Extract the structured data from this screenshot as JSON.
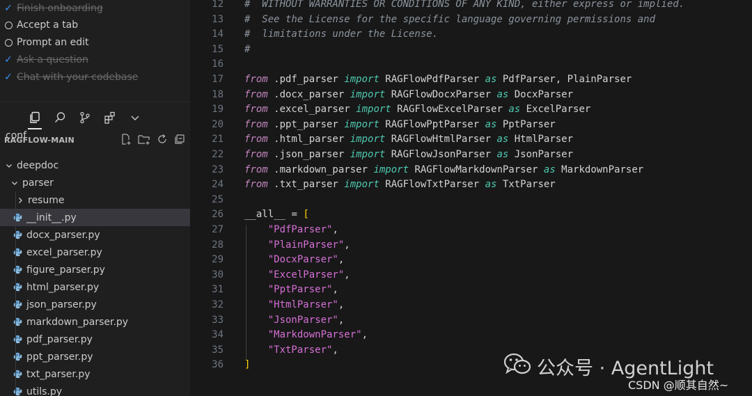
{
  "onboarding": {
    "items": [
      {
        "label": "Finish onboarding",
        "done": true
      },
      {
        "label": "Accept a tab",
        "done": false
      },
      {
        "label": "Prompt an edit",
        "done": false
      },
      {
        "label": "Ask a question",
        "done": true
      },
      {
        "label": "Chat with your codebase",
        "done": true
      }
    ]
  },
  "activity_bar": {
    "icons": [
      "files-icon",
      "search-icon",
      "source-control-icon",
      "extensions-icon",
      "chevron-down-icon"
    ]
  },
  "explorer": {
    "title": "RAGFLOW-MAIN",
    "actions": [
      "new-file-icon",
      "new-folder-icon",
      "refresh-icon",
      "collapse-all-icon"
    ],
    "tree": [
      {
        "label": "conf",
        "type": "folder"
      },
      {
        "label": "deepdoc",
        "type": "folder"
      },
      {
        "label": "parser",
        "type": "folder"
      },
      {
        "label": "resume",
        "type": "folder"
      },
      {
        "label": "__init__.py",
        "type": "file",
        "selected": true
      },
      {
        "label": "docx_parser.py",
        "type": "file"
      },
      {
        "label": "excel_parser.py",
        "type": "file"
      },
      {
        "label": "figure_parser.py",
        "type": "file"
      },
      {
        "label": "html_parser.py",
        "type": "file"
      },
      {
        "label": "json_parser.py",
        "type": "file"
      },
      {
        "label": "markdown_parser.py",
        "type": "file"
      },
      {
        "label": "pdf_parser.py",
        "type": "file"
      },
      {
        "label": "ppt_parser.py",
        "type": "file"
      },
      {
        "label": "txt_parser.py",
        "type": "file"
      },
      {
        "label": "utils.py",
        "type": "file"
      }
    ]
  },
  "editor": {
    "lines": [
      {
        "n": "12",
        "t": [
          [
            "#  WITHOUT WARRANTIES OR CONDITIONS OF ANY KIND, either express or implied.",
            "cm"
          ]
        ]
      },
      {
        "n": "13",
        "t": [
          [
            "#  See the License for the specific language governing permissions and",
            "cm"
          ]
        ]
      },
      {
        "n": "14",
        "t": [
          [
            "#  limitations under the License.",
            "cm"
          ]
        ]
      },
      {
        "n": "15",
        "t": [
          [
            "#",
            "cm"
          ]
        ]
      },
      {
        "n": "16",
        "t": []
      },
      {
        "n": "17",
        "t": [
          [
            "from",
            "kw"
          ],
          [
            " .pdf_parser ",
            "plain"
          ],
          [
            "import",
            "kw2"
          ],
          [
            " RAGFlowPdfParser ",
            "plain"
          ],
          [
            "as",
            "kw2"
          ],
          [
            " PdfParser, PlainParser",
            "plain"
          ]
        ]
      },
      {
        "n": "18",
        "t": [
          [
            "from",
            "kw"
          ],
          [
            " .docx_parser ",
            "plain"
          ],
          [
            "import",
            "kw2"
          ],
          [
            " RAGFlowDocxParser ",
            "plain"
          ],
          [
            "as",
            "kw2"
          ],
          [
            " DocxParser",
            "plain"
          ]
        ]
      },
      {
        "n": "19",
        "t": [
          [
            "from",
            "kw"
          ],
          [
            " .excel_parser ",
            "plain"
          ],
          [
            "import",
            "kw2"
          ],
          [
            " RAGFlowExcelParser ",
            "plain"
          ],
          [
            "as",
            "kw2"
          ],
          [
            " ExcelParser",
            "plain"
          ]
        ]
      },
      {
        "n": "20",
        "t": [
          [
            "from",
            "kw"
          ],
          [
            " .ppt_parser ",
            "plain"
          ],
          [
            "import",
            "kw2"
          ],
          [
            " RAGFlowPptParser ",
            "plain"
          ],
          [
            "as",
            "kw2"
          ],
          [
            " PptParser",
            "plain"
          ]
        ]
      },
      {
        "n": "21",
        "t": [
          [
            "from",
            "kw"
          ],
          [
            " .html_parser ",
            "plain"
          ],
          [
            "import",
            "kw2"
          ],
          [
            " RAGFlowHtmlParser ",
            "plain"
          ],
          [
            "as",
            "kw2"
          ],
          [
            " HtmlParser",
            "plain"
          ]
        ]
      },
      {
        "n": "22",
        "t": [
          [
            "from",
            "kw"
          ],
          [
            " .json_parser ",
            "plain"
          ],
          [
            "import",
            "kw2"
          ],
          [
            " RAGFlowJsonParser ",
            "plain"
          ],
          [
            "as",
            "kw2"
          ],
          [
            " JsonParser",
            "plain"
          ]
        ]
      },
      {
        "n": "23",
        "t": [
          [
            "from",
            "kw"
          ],
          [
            " .markdown_parser ",
            "plain"
          ],
          [
            "import",
            "kw2"
          ],
          [
            " RAGFlowMarkdownParser ",
            "plain"
          ],
          [
            "as",
            "kw2"
          ],
          [
            " MarkdownParser",
            "plain"
          ]
        ]
      },
      {
        "n": "24",
        "t": [
          [
            "from",
            "kw"
          ],
          [
            " .txt_parser ",
            "plain"
          ],
          [
            "import",
            "kw2"
          ],
          [
            " RAGFlowTxtParser ",
            "plain"
          ],
          [
            "as",
            "kw2"
          ],
          [
            " TxtParser",
            "plain"
          ]
        ]
      },
      {
        "n": "25",
        "t": []
      },
      {
        "n": "26",
        "t": [
          [
            "__all__",
            "plain"
          ],
          [
            " = ",
            "plain"
          ],
          [
            "[",
            "brk"
          ]
        ]
      },
      {
        "n": "27",
        "t": [
          [
            "    ",
            "plain"
          ],
          [
            "\"PdfParser\"",
            "str"
          ],
          [
            ",",
            "plain"
          ]
        ]
      },
      {
        "n": "28",
        "t": [
          [
            "    ",
            "plain"
          ],
          [
            "\"PlainParser\"",
            "str"
          ],
          [
            ",",
            "plain"
          ]
        ]
      },
      {
        "n": "29",
        "t": [
          [
            "    ",
            "plain"
          ],
          [
            "\"DocxParser\"",
            "str"
          ],
          [
            ",",
            "plain"
          ]
        ]
      },
      {
        "n": "30",
        "t": [
          [
            "    ",
            "plain"
          ],
          [
            "\"ExcelParser\"",
            "str"
          ],
          [
            ",",
            "plain"
          ]
        ]
      },
      {
        "n": "31",
        "t": [
          [
            "    ",
            "plain"
          ],
          [
            "\"PptParser\"",
            "str"
          ],
          [
            ",",
            "plain"
          ]
        ]
      },
      {
        "n": "32",
        "t": [
          [
            "    ",
            "plain"
          ],
          [
            "\"HtmlParser\"",
            "str"
          ],
          [
            ",",
            "plain"
          ]
        ]
      },
      {
        "n": "33",
        "t": [
          [
            "    ",
            "plain"
          ],
          [
            "\"JsonParser\"",
            "str"
          ],
          [
            ",",
            "plain"
          ]
        ]
      },
      {
        "n": "34",
        "t": [
          [
            "    ",
            "plain"
          ],
          [
            "\"MarkdownParser\"",
            "str"
          ],
          [
            ",",
            "plain"
          ]
        ]
      },
      {
        "n": "35",
        "t": [
          [
            "    ",
            "plain"
          ],
          [
            "\"TxtParser\"",
            "str"
          ],
          [
            ",",
            "plain"
          ]
        ]
      },
      {
        "n": "36",
        "t": [
          [
            "]",
            "brk"
          ]
        ]
      }
    ]
  },
  "watermark": {
    "text": "公众号 · AgentLight",
    "csdn": "CSDN @顺其自然~"
  }
}
